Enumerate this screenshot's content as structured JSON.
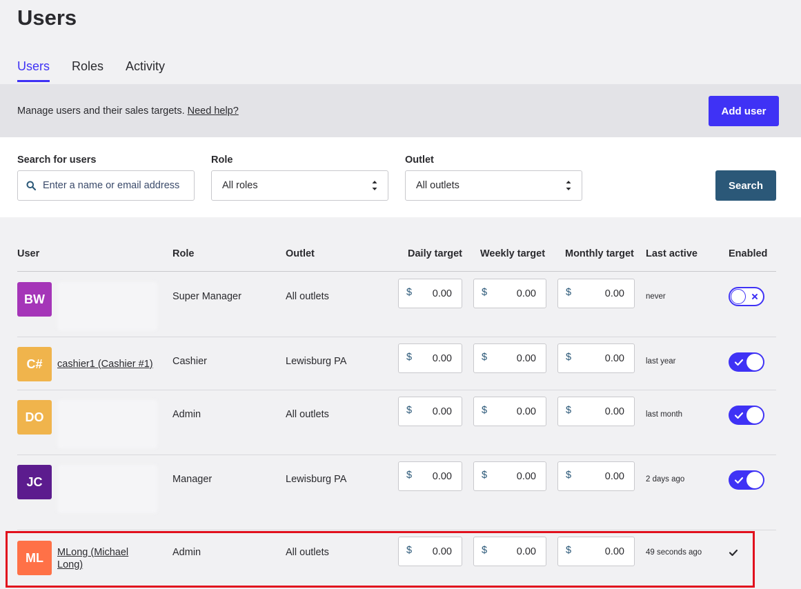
{
  "page": {
    "title": "Users"
  },
  "tabs": [
    {
      "label": "Users",
      "active": true
    },
    {
      "label": "Roles",
      "active": false
    },
    {
      "label": "Activity",
      "active": false
    }
  ],
  "banner": {
    "text": "Manage users and their sales targets.",
    "help_link": "Need help?",
    "add_button": "Add user"
  },
  "filters": {
    "search_label": "Search for users",
    "search_placeholder": "Enter a name or email address",
    "role_label": "Role",
    "role_value": "All roles",
    "outlet_label": "Outlet",
    "outlet_value": "All outlets",
    "search_button": "Search"
  },
  "table": {
    "columns": [
      "User",
      "Role",
      "Outlet",
      "Daily target",
      "Weekly target",
      "Monthly target",
      "Last active",
      "Enabled"
    ],
    "currency": "$",
    "rows": [
      {
        "initials": "BW",
        "color": "#a535b8",
        "name": "",
        "role": "Super Manager",
        "outlet": "All outlets",
        "daily": "0.00",
        "weekly": "0.00",
        "monthly": "0.00",
        "last_active": "never",
        "enabled": "off"
      },
      {
        "initials": "C#",
        "color": "#f0b44c",
        "name": "cashier1 (Cashier #1)",
        "role": "Cashier",
        "outlet": "Lewisburg PA",
        "daily": "0.00",
        "weekly": "0.00",
        "monthly": "0.00",
        "last_active": "last year",
        "enabled": "on"
      },
      {
        "initials": "DO",
        "color": "#f0b44c",
        "name": "",
        "role": "Admin",
        "outlet": "All outlets",
        "daily": "0.00",
        "weekly": "0.00",
        "monthly": "0.00",
        "last_active": "last month",
        "enabled": "on"
      },
      {
        "initials": "JC",
        "color": "#5c1c8e",
        "name": "",
        "role": "Manager",
        "outlet": "Lewisburg PA",
        "daily": "0.00",
        "weekly": "0.00",
        "monthly": "0.00",
        "last_active": "2 days ago",
        "enabled": "on"
      },
      {
        "initials": "ML",
        "color": "#ff7147",
        "name": "MLong (Michael Long)",
        "role": "Admin",
        "outlet": "All outlets",
        "daily": "0.00",
        "weekly": "0.00",
        "monthly": "0.00",
        "last_active": "49 seconds ago",
        "enabled": "check"
      }
    ]
  }
}
